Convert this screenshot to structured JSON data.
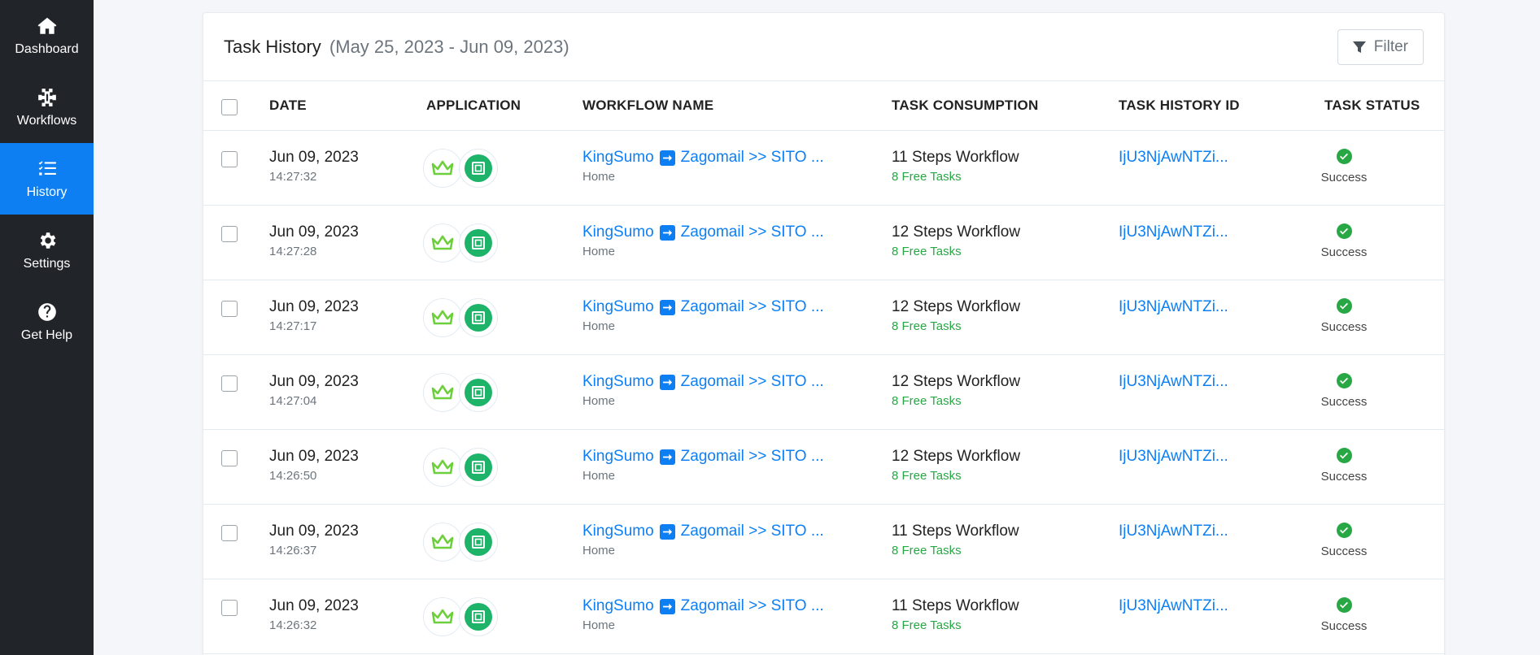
{
  "sidebar": {
    "items": [
      {
        "label": "Dashboard",
        "icon": "home-icon",
        "active": false
      },
      {
        "label": "Workflows",
        "icon": "workflow-icon",
        "active": false
      },
      {
        "label": "History",
        "icon": "history-list-icon",
        "active": true
      },
      {
        "label": "Settings",
        "icon": "gear-icon",
        "active": false
      },
      {
        "label": "Get Help",
        "icon": "question-circle-icon",
        "active": false
      }
    ]
  },
  "header": {
    "title": "Task History",
    "range": "(May 25, 2023 - Jun 09, 2023)",
    "filter_label": "Filter"
  },
  "table": {
    "columns": {
      "date": "DATE",
      "application": "APPLICATION",
      "workflow_name": "WORKFLOW NAME",
      "task_consumption": "TASK CONSUMPTION",
      "task_history_id": "TASK HISTORY ID",
      "task_status": "TASK STATUS"
    },
    "rows": [
      {
        "date": "Jun 09, 2023",
        "time": "14:27:32",
        "wf_from": "KingSumo",
        "wf_to": "Zagomail >> SITO ...",
        "folder": "Home",
        "steps": "11 Steps Workflow",
        "free": "8 Free Tasks",
        "id": "IjU3NjAwNTZi...",
        "status": "Success"
      },
      {
        "date": "Jun 09, 2023",
        "time": "14:27:28",
        "wf_from": "KingSumo",
        "wf_to": "Zagomail >> SITO ...",
        "folder": "Home",
        "steps": "12 Steps Workflow",
        "free": "8 Free Tasks",
        "id": "IjU3NjAwNTZi...",
        "status": "Success"
      },
      {
        "date": "Jun 09, 2023",
        "time": "14:27:17",
        "wf_from": "KingSumo",
        "wf_to": "Zagomail >> SITO ...",
        "folder": "Home",
        "steps": "12 Steps Workflow",
        "free": "8 Free Tasks",
        "id": "IjU3NjAwNTZi...",
        "status": "Success"
      },
      {
        "date": "Jun 09, 2023",
        "time": "14:27:04",
        "wf_from": "KingSumo",
        "wf_to": "Zagomail >> SITO ...",
        "folder": "Home",
        "steps": "12 Steps Workflow",
        "free": "8 Free Tasks",
        "id": "IjU3NjAwNTZi...",
        "status": "Success"
      },
      {
        "date": "Jun 09, 2023",
        "time": "14:26:50",
        "wf_from": "KingSumo",
        "wf_to": "Zagomail >> SITO ...",
        "folder": "Home",
        "steps": "12 Steps Workflow",
        "free": "8 Free Tasks",
        "id": "IjU3NjAwNTZi...",
        "status": "Success"
      },
      {
        "date": "Jun 09, 2023",
        "time": "14:26:37",
        "wf_from": "KingSumo",
        "wf_to": "Zagomail >> SITO ...",
        "folder": "Home",
        "steps": "11 Steps Workflow",
        "free": "8 Free Tasks",
        "id": "IjU3NjAwNTZi...",
        "status": "Success"
      },
      {
        "date": "Jun 09, 2023",
        "time": "14:26:32",
        "wf_from": "KingSumo",
        "wf_to": "Zagomail >> SITO ...",
        "folder": "Home",
        "steps": "11 Steps Workflow",
        "free": "8 Free Tasks",
        "id": "IjU3NjAwNTZi...",
        "status": "Success"
      }
    ]
  },
  "colors": {
    "sidebar_bg": "#212529",
    "accent": "#0d7ff3",
    "success": "#28a745",
    "app_green": "#1db46a"
  }
}
